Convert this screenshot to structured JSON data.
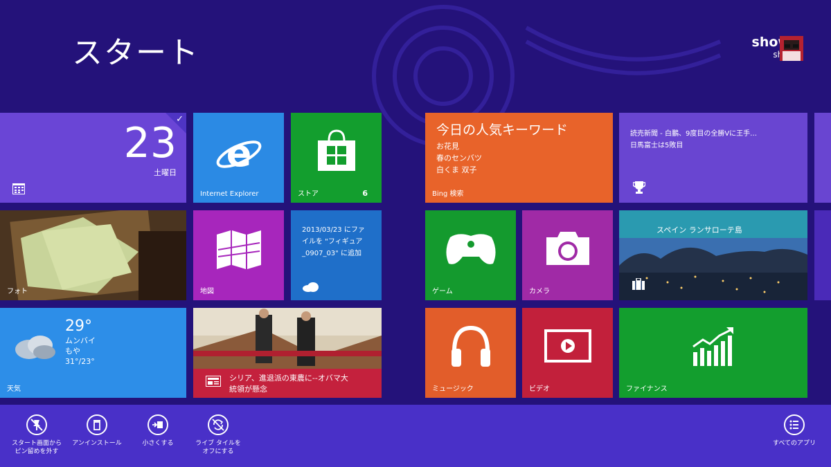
{
  "screen": {
    "title": "スタート"
  },
  "user": {
    "name": "showji",
    "sub": "showji"
  },
  "tiles": {
    "calendar": {
      "day_number": "23",
      "weekday": "土曜日"
    },
    "ie": {
      "label": "Internet Explorer"
    },
    "store": {
      "label": "ストア",
      "count": "6"
    },
    "bing": {
      "headline": "今日の人気キーワード",
      "items": [
        "お花見",
        "春のセンバツ",
        "白くま 双子"
      ],
      "label": "Bing 検索"
    },
    "news_sports": {
      "line1": "読売新聞 - 白鵬、9度目の全勝Vに王手…",
      "line2": "日馬富士は5敗目"
    },
    "photos": {
      "label": "フォト"
    },
    "maps": {
      "label": "地図"
    },
    "skydrive": {
      "line1": "2013/03/23 にファ",
      "line2": "イルを \"フィギュア",
      "line3": "_0907_03\" に追加"
    },
    "games": {
      "label": "ゲーム"
    },
    "camera": {
      "label": "カメラ"
    },
    "travel": {
      "caption": "スペイン ランサローテ島"
    },
    "weather": {
      "temp": "29°",
      "city": "ムンバイ",
      "condition": "もや",
      "range": "31°/23°",
      "label": "天気"
    },
    "news": {
      "headline_line1": "シリア、進退派の東農に--オバマ大",
      "headline_line2": "統領が懸念"
    },
    "music": {
      "label": "ミュージック"
    },
    "video": {
      "label": "ビデオ"
    },
    "finance": {
      "label": "ファイナンス"
    }
  },
  "app_bar": {
    "unpin": {
      "line1": "スタート画面から",
      "line2": "ピン留めを外す"
    },
    "uninstall": {
      "line1": "アンインストール"
    },
    "resize": {
      "line1": "小さくする"
    },
    "live_tile": {
      "line1": "ライブ タイルを",
      "line2": "オフにする"
    },
    "all_apps": {
      "line1": "すべてのアプリ"
    }
  },
  "colors": {
    "background": "#24127a",
    "app_bar": "#4930c8",
    "calendar": "#6a45d6",
    "ie": "#2b8ae4",
    "store": "#139e2e",
    "bing": "#e8632a",
    "news_sports": "#6945d1",
    "maps": "#a726bc",
    "skydrive": "#1f6fc9",
    "games": "#149a2e",
    "camera": "#a02aa6",
    "weather": "#2d8ee8",
    "news": "#c4213d",
    "music": "#e25d2a",
    "video": "#c2203b",
    "finance": "#139e2e"
  }
}
